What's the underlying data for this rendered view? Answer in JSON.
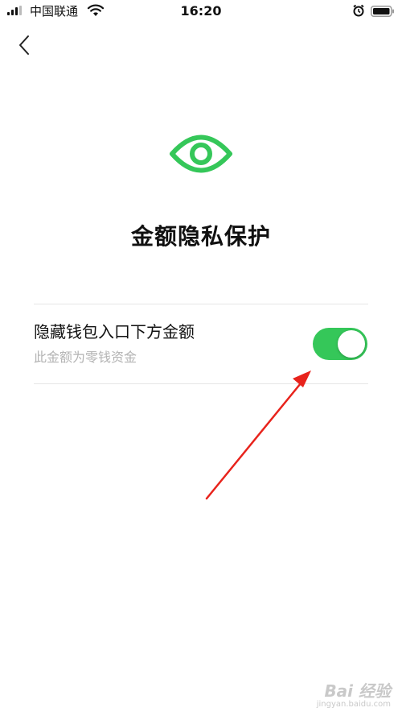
{
  "status_bar": {
    "carrier": "中国联通",
    "time": "16:20"
  },
  "page": {
    "title": "金额隐私保护",
    "accent_color": "#35c759"
  },
  "setting": {
    "label": "隐藏钱包入口下方金额",
    "description": "此金额为零钱资金",
    "toggle_on": true
  },
  "icons": {
    "back": "chevron-left-icon",
    "eye": "eye-icon"
  },
  "watermark": {
    "brand": "Bai 经验",
    "url": "jingyan.baidu.com"
  }
}
